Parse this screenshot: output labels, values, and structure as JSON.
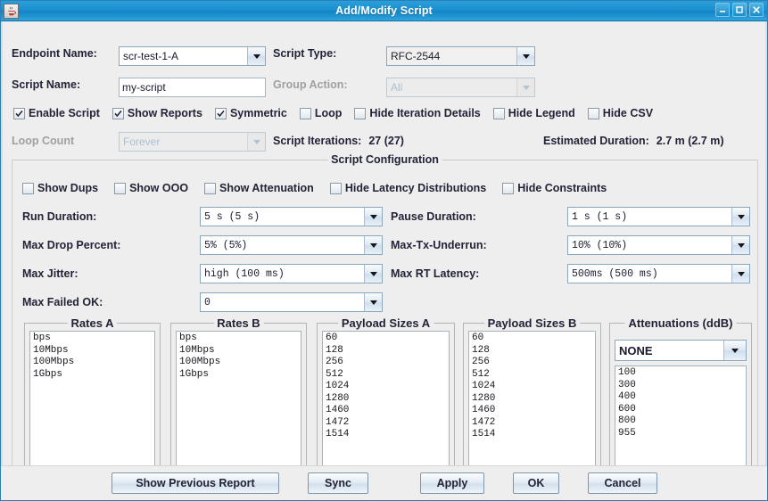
{
  "window": {
    "title": "Add/Modify Script",
    "icon": "java-coffee-cup-icon",
    "minimize_label": "–",
    "maximize_label": "□",
    "close_label": "✕"
  },
  "form": {
    "endpoint_name_label": "Endpoint Name:",
    "endpoint_name_value": "scr-test-1-A",
    "script_type_label": "Script Type:",
    "script_type_value": "RFC-2544",
    "script_name_label": "Script Name:",
    "script_name_value": "my-script",
    "group_action_label": "Group Action:",
    "group_action_value": "All",
    "loop_count_label": "Loop Count",
    "loop_count_value": "Forever",
    "script_iterations_label": "Script Iterations:",
    "script_iterations_value": "27 (27)",
    "estimated_duration_label": "Estimated Duration:",
    "estimated_duration_value": "2.7 m (2.7 m)"
  },
  "top_checkboxes": [
    {
      "label": "Enable Script",
      "checked": true
    },
    {
      "label": "Show Reports",
      "checked": true
    },
    {
      "label": "Symmetric",
      "checked": true
    },
    {
      "label": "Loop",
      "checked": false
    },
    {
      "label": "Hide Iteration Details",
      "checked": false
    },
    {
      "label": "Hide Legend",
      "checked": false
    },
    {
      "label": "Hide CSV",
      "checked": false
    }
  ],
  "script_configuration": {
    "title": "Script Configuration",
    "checkboxes": [
      {
        "label": "Show Dups",
        "checked": false
      },
      {
        "label": "Show OOO",
        "checked": false
      },
      {
        "label": "Show Attenuation",
        "checked": false
      },
      {
        "label": "Hide Latency Distributions",
        "checked": false
      },
      {
        "label": "Hide Constraints",
        "checked": false
      }
    ],
    "fields": {
      "run_duration_label": "Run Duration:",
      "run_duration_value": "5 s    (5 s)",
      "pause_duration_label": "Pause Duration:",
      "pause_duration_value": "1 s    (1 s)",
      "max_drop_percent_label": "Max Drop Percent:",
      "max_drop_percent_value": "5% (5%)",
      "max_tx_underrun_label": "Max-Tx-Underrun:",
      "max_tx_underrun_value": "10% (10%)",
      "max_jitter_label": "Max Jitter:",
      "max_jitter_value": "high (100 ms)",
      "max_rt_latency_label": "Max RT Latency:",
      "max_rt_latency_value": "500ms (500 ms)",
      "max_failed_ok_label": "Max Failed OK:",
      "max_failed_ok_value": "0"
    },
    "lists": {
      "rates_a_title": "Rates A",
      "rates_a": [
        "bps",
        "10Mbps",
        "100Mbps",
        "1Gbps"
      ],
      "rates_b_title": "Rates B",
      "rates_b": [
        "bps",
        "10Mbps",
        "100Mbps",
        "1Gbps"
      ],
      "payload_sizes_a_title": "Payload Sizes A",
      "payload_sizes_a": [
        "60",
        "128",
        "256",
        "512",
        "1024",
        "1280",
        "1460",
        "1472",
        "1514"
      ],
      "payload_sizes_b_title": "Payload Sizes B",
      "payload_sizes_b": [
        "60",
        "128",
        "256",
        "512",
        "1024",
        "1280",
        "1460",
        "1472",
        "1514"
      ],
      "attenuations_title": "Attenuations (ddB)",
      "attenuations_selected": "NONE",
      "attenuations": [
        "100",
        "300",
        "400",
        "600",
        "800",
        "955"
      ]
    }
  },
  "buttons": {
    "show_previous_report": "Show Previous Report",
    "sync": "Sync",
    "apply": "Apply",
    "ok": "OK",
    "cancel": "Cancel"
  }
}
